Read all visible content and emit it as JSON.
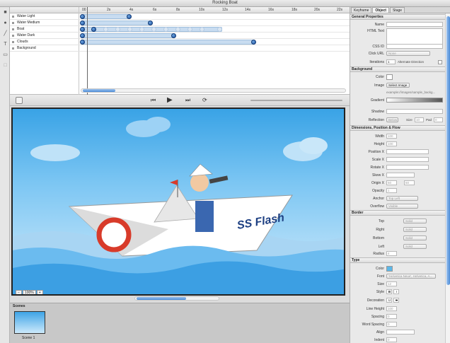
{
  "window": {
    "title": "Rocking Boat"
  },
  "timeline": {
    "ruler_first": "00",
    "ticks": [
      "2s",
      "4s",
      "6s",
      "8s",
      "10s",
      "12s",
      "14s",
      "16s",
      "18s",
      "20s",
      "22s"
    ],
    "layers": [
      {
        "name": "Water Light"
      },
      {
        "name": "Water Medium"
      },
      {
        "name": "Boat"
      },
      {
        "name": "Water Dark"
      },
      {
        "name": "Clouds"
      },
      {
        "name": "Background"
      }
    ]
  },
  "stage": {
    "zoom": "100%",
    "zoom_minus": "−",
    "zoom_plus": "+",
    "boat_text": "SS Flash"
  },
  "scenes": {
    "header": "Scenes",
    "items": [
      {
        "label": "Scene 1"
      }
    ]
  },
  "inspector": {
    "tabs": [
      "Keyframe",
      "Object",
      "Stage"
    ],
    "general": {
      "header": "General Properties",
      "name_label": "Name",
      "html_label": "HTML Text",
      "css_label": "CSS ID",
      "click_label": "Click URL",
      "click_value": "None",
      "iter_label": "Iterations",
      "iter_value": "1",
      "alt_label": "Alternate Direction"
    },
    "background": {
      "header": "Background",
      "color_label": "Color",
      "image_label": "Image",
      "image_button": "Select Image",
      "image_example": "example://images/sample_backg...",
      "gradient_label": "Gradient",
      "shadow_label": "Shadow",
      "reflection_label": "Reflection",
      "reflection_value": "Below",
      "size_label": "Size",
      "size_value": "10",
      "pad_label": "Pad",
      "pad_value": "0"
    },
    "dims": {
      "header": "Dimensions, Position & Flow",
      "width_label": "Width",
      "width_value": "100",
      "height_label": "Height",
      "height_value": "100",
      "pos_label": "Position X",
      "scale_label": "Scale X",
      "rot_label": "Rotate X",
      "skew_label": "Skew X",
      "origin_label": "Origin X",
      "origin_x": "50",
      "origin_y": "50",
      "opacity_label": "Opacity",
      "opacity_value": "1",
      "anchor_label": "Anchor",
      "anchor_value": "Top Left",
      "overflow_label": "Overflow",
      "overflow_value": "Visible"
    },
    "border": {
      "header": "Border",
      "top": "Top",
      "right": "Right",
      "bottom": "Bottom",
      "left": "Left",
      "style_value": "Solid",
      "width_value": "1",
      "radius_label": "Radius",
      "radius_value": "4"
    },
    "type": {
      "header": "Type",
      "color_label": "Color",
      "color_value": "#5cb8e8",
      "font_label": "Font",
      "font_value": "'Helvetica Neue', Helvetica, A...",
      "size_label": "Size",
      "size_value": "12",
      "style_label": "Style",
      "decoration_label": "Decoration",
      "lineheight_label": "Line Height",
      "lineheight_value": "100",
      "spacing_label": "Spacing",
      "spacing_value": "0",
      "wordspacing_label": "Word Spacing",
      "wordspacing_value": "0",
      "align_label": "Align",
      "indent_label": "Indent",
      "indent_value": "0"
    }
  }
}
